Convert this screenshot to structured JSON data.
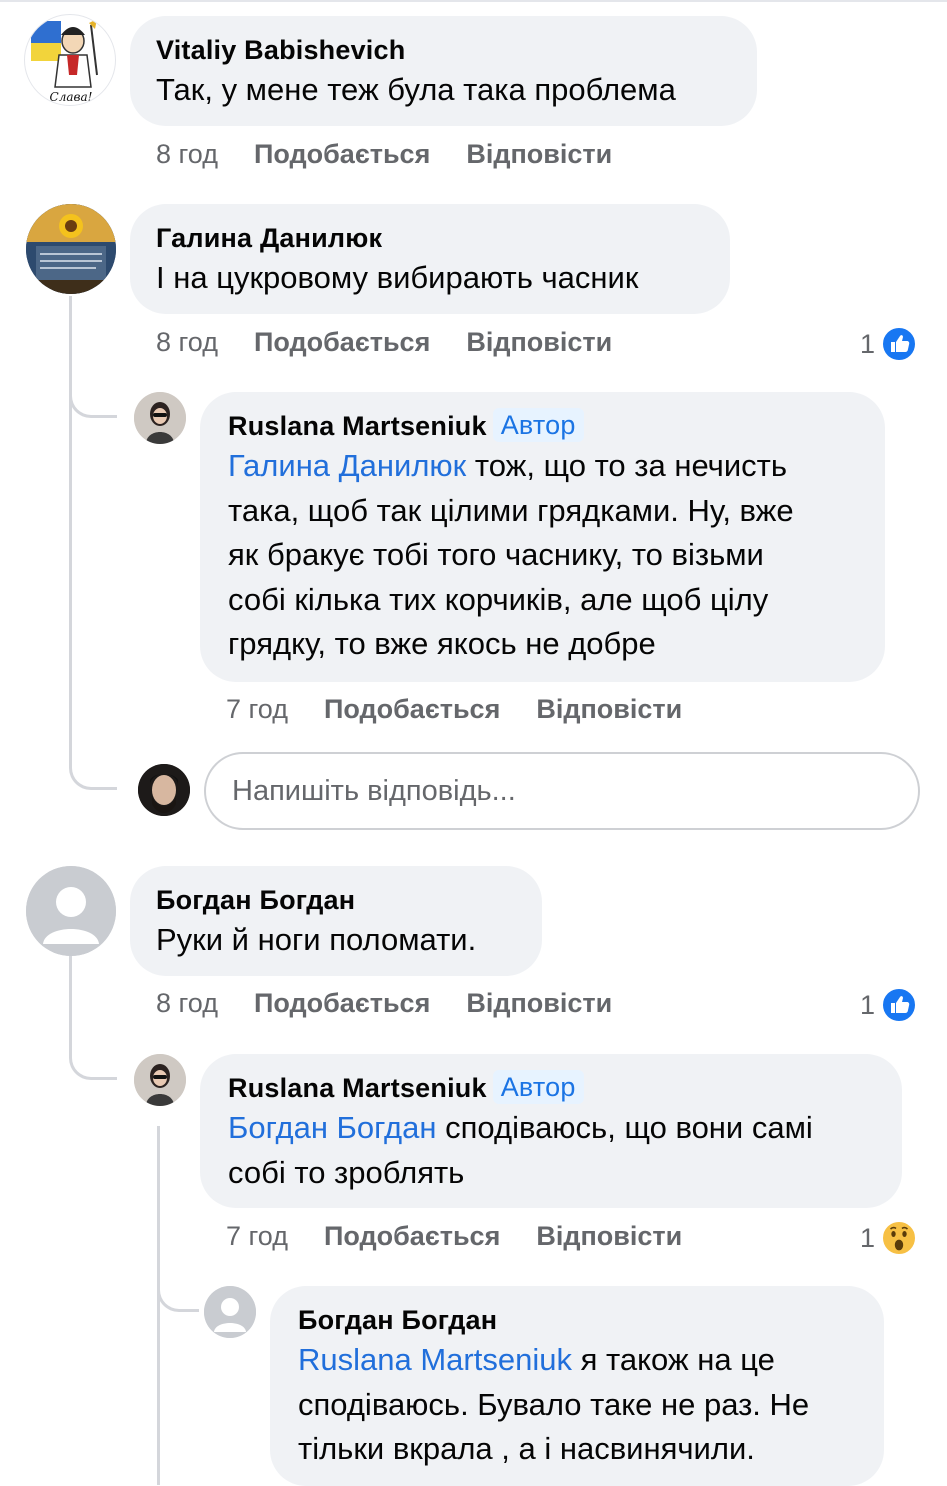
{
  "comments": [
    {
      "author": "Vitaliy  Babishevich",
      "avatar_icon": "cossack-slava-avatar",
      "avatar_text": "Слава!",
      "text": "Так, у мене теж була така проблема",
      "time": "8 год",
      "like_label": "Подобається",
      "reply_label": "Відповісти"
    },
    {
      "author": "Галина Данилюк",
      "avatar_icon": "sunflower-avatar",
      "text": "І на цукровому  вибирають часник",
      "time": "8 год",
      "like_label": "Подобається",
      "reply_label": "Відповісти",
      "reaction_count": "1",
      "reaction_icon": "like-icon",
      "replies": [
        {
          "author": "Ruslana Martseniuk",
          "badge": "Автор",
          "mention": "Галина Данилюк",
          "text_line1": " тож, що то за нечисть",
          "text_rest": [
            "така, щоб так цілими грядками. Ну, вже",
            "як бракує тобі того часнику, то візьми",
            "собі кілька тих корчиків, але щоб цілу",
            "грядку, то вже якось не добре"
          ],
          "time": "7 год",
          "like_label": "Подобається",
          "reply_label": "Відповісти"
        }
      ],
      "reply_input": {
        "placeholder": "Напишіть відповідь..."
      }
    },
    {
      "author": "Богдан Богдан",
      "avatar_icon": "default-user-avatar",
      "text": "Руки й ноги поломати.",
      "time": "8 год",
      "like_label": "Подобається",
      "reply_label": "Відповісти",
      "reaction_count": "1",
      "reaction_icon": "like-icon",
      "replies": [
        {
          "author": "Ruslana Martseniuk",
          "badge": "Автор",
          "mention": "Богдан Богдан",
          "text_line1": " сподіваюсь, що вони самі",
          "text_rest": [
            "собі то зроблять"
          ],
          "time": "7 год",
          "like_label": "Подобається",
          "reply_label": "Відповісти",
          "reaction_count": "1",
          "reaction_icon": "wow-icon"
        },
        {
          "author": "Богдан Богдан",
          "mention": "Ruslana Martseniuk",
          "text_line1": " я також на це",
          "text_rest": [
            "сподіваюсь. Бувало таке не раз. Не",
            "тільки вкрала , а і насвинячили."
          ]
        }
      ]
    }
  ],
  "colors": {
    "bubble": "#f0f2f5",
    "mention": "#216fdb",
    "badge_bg": "#e7f3ff",
    "badge_text": "#1b74e4",
    "meta": "#65676b",
    "like_blue": "#1877f2",
    "wow_yellow": "#f7c044"
  }
}
